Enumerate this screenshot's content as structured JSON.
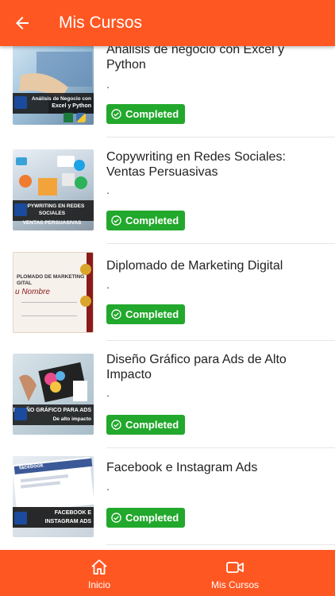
{
  "header": {
    "title": "Mis Cursos",
    "back_icon": "arrow-left-icon",
    "background": "#ff5722"
  },
  "courses": [
    {
      "title": "Análisis de negocio con Excel y Python",
      "subtitle": ".",
      "status": "Completed",
      "thumb_caption_1": "Análisis de Negocio con",
      "thumb_caption_2": "Excel y Python"
    },
    {
      "title": "Copywriting en Redes Sociales: Ventas Persuasivas",
      "subtitle": ".",
      "status": "Completed",
      "thumb_caption_1": "COPYWRITING EN REDES SOCIALES",
      "thumb_caption_2": "VENTAS PERSUASIVAS"
    },
    {
      "title": "Diplomado de Marketing Digital",
      "subtitle": ".",
      "status": "Completed",
      "thumb_caption_1": "PLOMADO DE MARKETING",
      "thumb_caption_2": "GITAL",
      "thumb_caption_3": "u Nombre"
    },
    {
      "title": "Diseño Gráfico para Ads de Alto Impacto",
      "subtitle": ".",
      "status": "Completed",
      "thumb_caption_1": "DISEÑO GRÁFICO PARA ADS",
      "thumb_caption_2": "De alto impacto"
    },
    {
      "title": "Facebook e Instagram Ads",
      "subtitle": ".",
      "status": "Completed",
      "thumb_caption_1": "FACEBOOK E",
      "thumb_caption_2": "INSTAGRAM ADS",
      "thumb_caption_3": "facebook"
    }
  ],
  "status_color": "#22a82c",
  "bottom_nav": [
    {
      "label": "Inicio",
      "icon": "home-icon"
    },
    {
      "label": "Mis Cursos",
      "icon": "video-camera-icon"
    }
  ]
}
